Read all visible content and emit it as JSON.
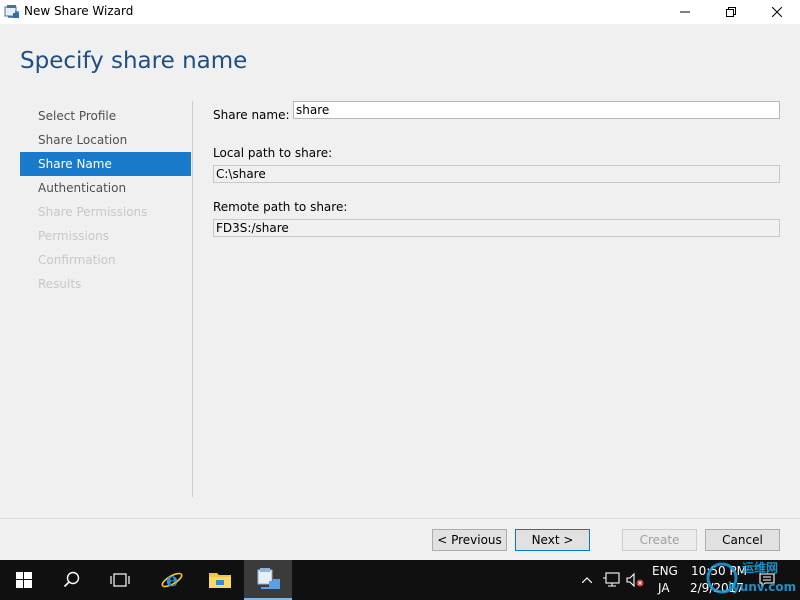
{
  "window": {
    "title": "New Share Wizard",
    "controls": {
      "minimize": "minimize",
      "restore": "restore",
      "close": "close"
    }
  },
  "page": {
    "title": "Specify share name"
  },
  "steps": [
    {
      "label": "Select Profile",
      "state": "normal"
    },
    {
      "label": "Share Location",
      "state": "normal"
    },
    {
      "label": "Share Name",
      "state": "active"
    },
    {
      "label": "Authentication",
      "state": "normal"
    },
    {
      "label": "Share Permissions",
      "state": "disabled"
    },
    {
      "label": "Permissions",
      "state": "disabled"
    },
    {
      "label": "Confirmation",
      "state": "disabled"
    },
    {
      "label": "Results",
      "state": "disabled"
    }
  ],
  "form": {
    "share_name_label": "Share name:",
    "share_name_value": "share",
    "local_path_label": "Local path to share:",
    "local_path_value": "C:\\share",
    "remote_path_label": "Remote path to share:",
    "remote_path_value": "FD3S:/share"
  },
  "buttons": {
    "previous": "< Previous",
    "next": "Next >",
    "create": "Create",
    "cancel": "Cancel"
  },
  "taskbar": {
    "lang_top": "ENG",
    "lang_bottom": "JA",
    "time": "10:50 PM",
    "date": "2/9/2017"
  },
  "watermark": {
    "top": "运维网",
    "bottom": "iyunv.com"
  },
  "colors": {
    "accent": "#1979ca",
    "title_blue": "#1e4f83",
    "taskbar": "#101010"
  }
}
